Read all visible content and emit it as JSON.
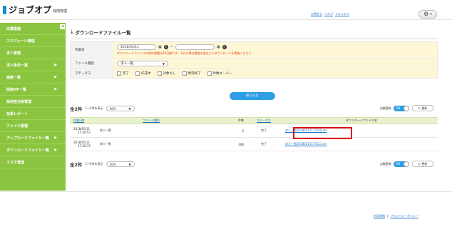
{
  "header": {
    "logo_text": "ジョブオプ",
    "logo_sub": "採用管理",
    "links": [
      "お問合せ",
      "ヘルプ",
      "マニュアル"
    ]
  },
  "sidebar": {
    "items": [
      {
        "label": "応募管理",
        "arrow": false
      },
      {
        "label": "スケジュール管理",
        "arrow": false
      },
      {
        "label": "求人管理",
        "arrow": false
      },
      {
        "label": "求人条件一覧",
        "arrow": true
      },
      {
        "label": "画像一覧",
        "arrow": true
      },
      {
        "label": "採用HP一覧",
        "arrow": true
      },
      {
        "label": "採用担当者管理",
        "arrow": false
      },
      {
        "label": "効果レポート",
        "arrow": false
      },
      {
        "label": "ファイル管理",
        "arrow": false
      },
      {
        "label": "アップロードファイル一覧",
        "arrow": true
      },
      {
        "label": "ダウンロードファイル一覧",
        "arrow": true
      },
      {
        "label": "マスタ管理",
        "arrow": false
      }
    ]
  },
  "page": {
    "title": "ダウンロードファイル一覧"
  },
  "form": {
    "date_label": "作業日",
    "date_from": "2018/05/11",
    "date_to": "",
    "tilde": "~",
    "note": "ダウンロードファイルの保存期間は30日間です。それ以降は履歴を過去よりダウンロードを実施ください",
    "type_label": "ファイル種別",
    "type_value": "求人一覧",
    "status_label": "ステータス",
    "status_options": [
      "完了",
      "作成中",
      "対象なし",
      "異常終了",
      "件数オーバー"
    ]
  },
  "search_button": "絞り込む",
  "pager": {
    "count": "全2件",
    "range": "1〜2件を表示",
    "per_page": "50件",
    "auto_label": "自動更新",
    "toggle": "ON",
    "refresh": "更新"
  },
  "list": {
    "headers": {
      "date": "作業日▼",
      "type": "ファイル種別",
      "count": "件数",
      "status": "ステータス",
      "file": "ダウンロードファイル名"
    },
    "rows": [
      {
        "date": "2018/05/11",
        "time": "17:30:57",
        "type": "求人一覧",
        "count": "2",
        "status": "完了",
        "file": "求人一覧20180511173128.xls"
      },
      {
        "date": "2018/05/11",
        "time": "17:29:37",
        "type": "求人一覧",
        "count": "406",
        "status": "完了",
        "file": "求人一覧20180511173112.xls"
      }
    ]
  },
  "footer": {
    "links": [
      "利用規約",
      "プライバシーポリシー"
    ],
    "sep": "|"
  },
  "colors": {
    "sidebar": "#8bc53f",
    "accent": "#2d9de5",
    "highlight": "#e01010"
  }
}
